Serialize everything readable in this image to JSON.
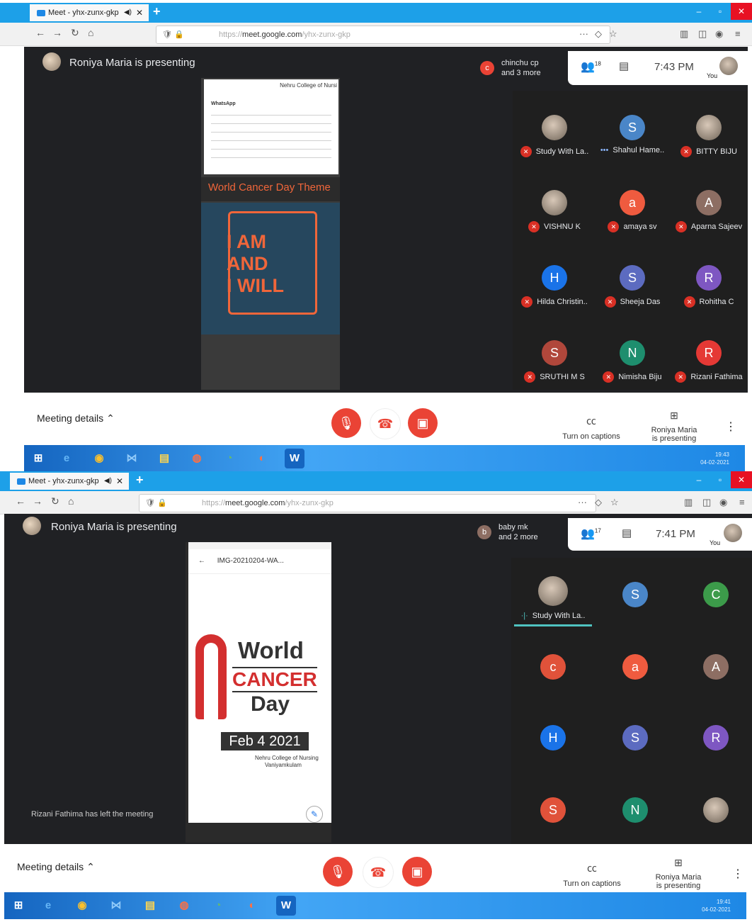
{
  "browser": {
    "tab_title": "Meet - yhx-zunx-gkp",
    "url_domain": "meet.google.com",
    "url_prefix": "https://",
    "url_path": "/yhx-zunx-gkp"
  },
  "top": {
    "presenting_text": "Roniya Maria is presenting",
    "pill_name": "chinchu cp",
    "pill_more": "and 3 more",
    "pill_initial": "c",
    "people_count": "18",
    "time": "7:43 PM",
    "you_label": "You",
    "doc_header": "Nehru College of Nursi",
    "doc_chat_title": "WhatsApp",
    "slide_title": "World Cancer Day Theme",
    "slide_lines": [
      "I AM",
      "AND",
      "I WILL"
    ],
    "participants": [
      {
        "name": "Study With La..",
        "initial": "",
        "color": "",
        "muted": true
      },
      {
        "name": "Shahul Hame..",
        "initial": "S",
        "color": "#4a86c8",
        "muted": false
      },
      {
        "name": "BITTY BIJU",
        "initial": "",
        "color": "",
        "muted": true
      },
      {
        "name": "VISHNU K",
        "initial": "",
        "color": "",
        "muted": true
      },
      {
        "name": "amaya sv",
        "initial": "a",
        "color": "#ef5b3f",
        "muted": true
      },
      {
        "name": "Aparna Sajeev",
        "initial": "A",
        "color": "#8d6e63",
        "muted": true
      },
      {
        "name": "Hilda Christin..",
        "initial": "H",
        "color": "#1a73e8",
        "muted": true
      },
      {
        "name": "Sheeja Das",
        "initial": "S",
        "color": "#5c6bc0",
        "muted": true
      },
      {
        "name": "Rohitha C",
        "initial": "R",
        "color": "#7e57c2",
        "muted": true
      },
      {
        "name": "SRUTHI M S",
        "initial": "S",
        "color": "#b0473b",
        "muted": true
      },
      {
        "name": "Nimisha Biju",
        "initial": "N",
        "color": "#1e8e6e",
        "muted": true
      },
      {
        "name": "Rizani Fathima",
        "initial": "R",
        "color": "#e53935",
        "muted": true
      }
    ],
    "meeting_details": "Meeting details",
    "captions_label": "Turn on captions",
    "presenting_label": "Roniya Maria is presenting"
  },
  "bottom": {
    "presenting_text": "Roniya Maria is presenting",
    "pill_name": "baby mk",
    "pill_more": "and 2 more",
    "pill_initial": "b",
    "people_count": "17",
    "time": "7:41 PM",
    "you_label": "You",
    "phone_file": "IMG-20210204-WA...",
    "poster_world": "World",
    "poster_cancer": "CANCER",
    "poster_day": "Day",
    "poster_date": "Feb 4 2021",
    "poster_org": "Nehru College of Nursing",
    "poster_place": "Vaniyamkulam",
    "left_meeting": "Rizani Fathima has left the meeting",
    "speaker_name": "Study With La..",
    "participants": [
      {
        "initial": "S",
        "color": "#4a86c8"
      },
      {
        "initial": "C",
        "color": "#3c9b4a"
      },
      {
        "initial": "c",
        "color": "#e0523a"
      },
      {
        "initial": "a",
        "color": "#ef5b3f"
      },
      {
        "initial": "A",
        "color": "#8d6e63"
      },
      {
        "initial": "H",
        "color": "#1a73e8"
      },
      {
        "initial": "S",
        "color": "#5c6bc0"
      },
      {
        "initial": "R",
        "color": "#7e57c2"
      },
      {
        "initial": "S",
        "color": "#e0523a"
      },
      {
        "initial": "N",
        "color": "#1e8e6e"
      },
      {
        "initial": "",
        "color": ""
      }
    ],
    "meeting_details": "Meeting details",
    "captions_label": "Turn on captions",
    "presenting_label": "Roniya Maria is presenting"
  },
  "taskbar": {
    "top_time": "19:43",
    "top_date": "04-02-2021",
    "bottom_time": "19:41",
    "bottom_date": "04-02-2021"
  }
}
